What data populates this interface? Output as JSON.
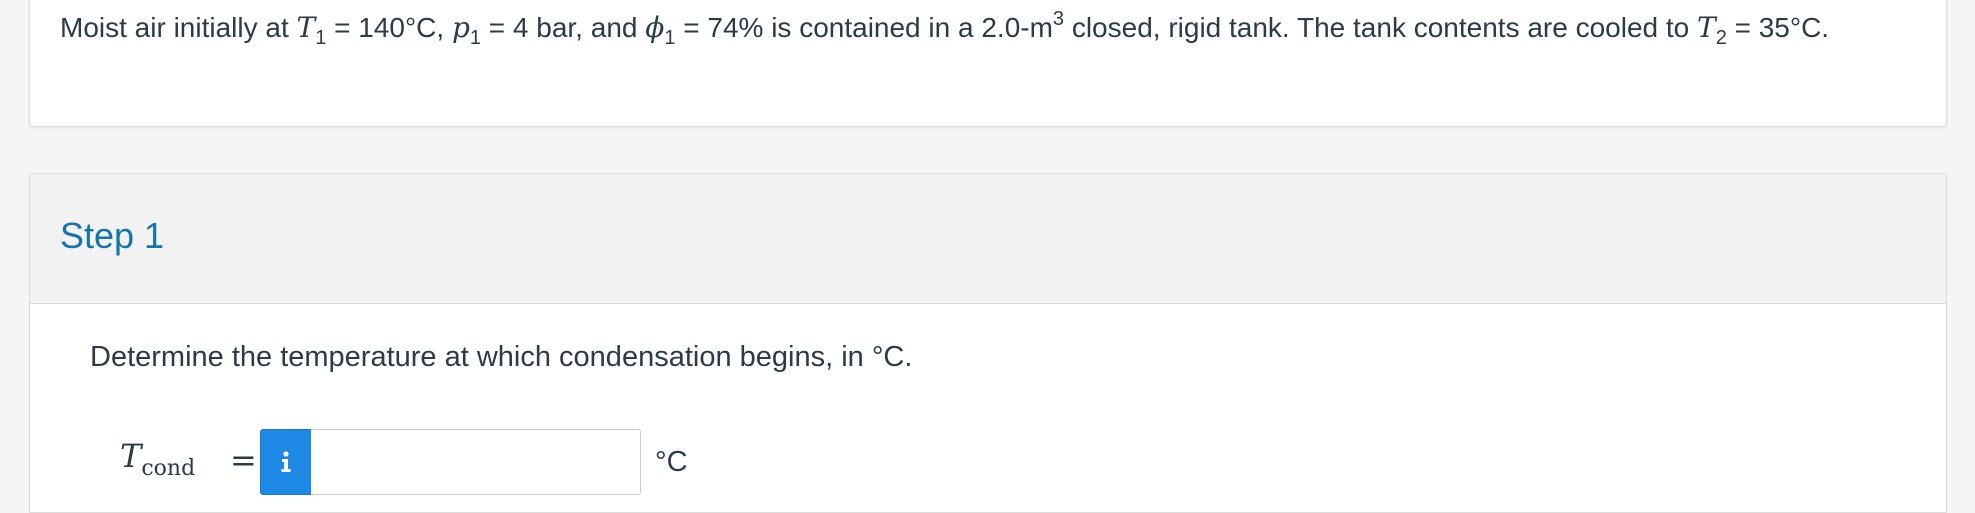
{
  "problem": {
    "part1": "Moist air initially at ",
    "T_symbol": "T",
    "T_sub": "1",
    "part2": " = 140°C, ",
    "p_symbol": "p",
    "p_sub": "1",
    "part3": " = 4 bar, and ",
    "phi_symbol": "ϕ",
    "phi_sub": "1",
    "part4": " = 74% is contained in a 2.0-m",
    "m_sup": "3",
    "part5": " closed, rigid tank. The tank contents are cooled to ",
    "T2_symbol": "T",
    "T2_sub": "2",
    "part6": " = 35°C."
  },
  "step": {
    "title": "Step 1",
    "question": "Determine the temperature at which condensation begins, in °C.",
    "answer": {
      "var_symbol": "T",
      "var_sub": "cond",
      "equals": "=",
      "info_icon": "info-icon",
      "value": "",
      "placeholder": "",
      "unit": "°C"
    }
  },
  "colors": {
    "accent": "#1476a6",
    "info_button": "#1e88e5"
  }
}
